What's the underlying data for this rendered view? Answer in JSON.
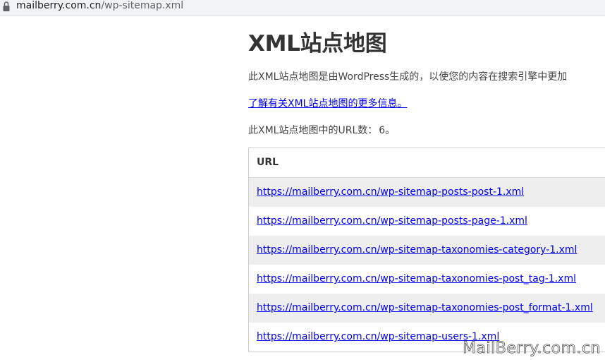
{
  "browser": {
    "address_domain": "mailberry.com.cn",
    "address_path": "/wp-sitemap.xml",
    "lock_icon": "lock-icon"
  },
  "page": {
    "title": "XML站点地图",
    "description": "此XML站点地图是由WordPress生成的，以使您的内容在搜索引擎中更加",
    "more_link": "了解有关XML站点地图的更多信息。",
    "count_label": "此XML站点地图中的URL数：",
    "count_value": "6。"
  },
  "table": {
    "header": "URL",
    "rows": [
      "https://mailberry.com.cn/wp-sitemap-posts-post-1.xml",
      "https://mailberry.com.cn/wp-sitemap-posts-page-1.xml",
      "https://mailberry.com.cn/wp-sitemap-taxonomies-category-1.xml",
      "https://mailberry.com.cn/wp-sitemap-taxonomies-post_tag-1.xml",
      "https://mailberry.com.cn/wp-sitemap-taxonomies-post_format-1.xml",
      "https://mailberry.com.cn/wp-sitemap-users-1.xml"
    ]
  },
  "watermark": "MailBerry.com.cn"
}
